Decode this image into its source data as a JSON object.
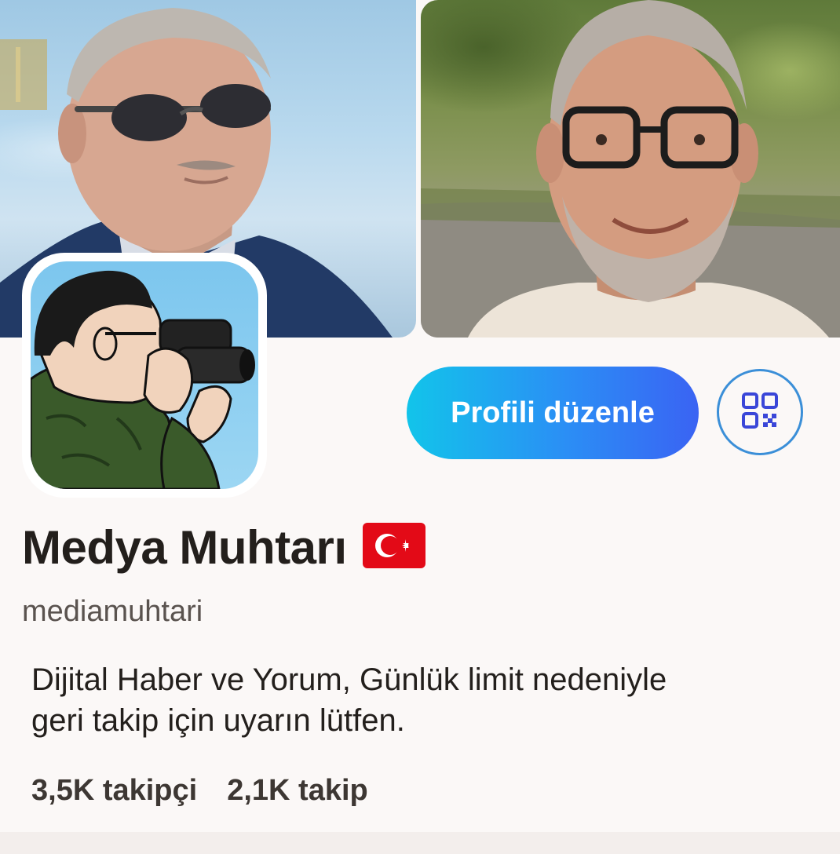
{
  "profile": {
    "display_name": "Medya Muhtarı",
    "flag_emoji": "🇹🇷",
    "handle": "mediamuhtari",
    "bio_line1": "Dijital Haber ve Yorum, Günlük limit nedeniyle",
    "bio_line2": "geri takip için uyarın lütfen.",
    "followers_label": "3,5K takipçi",
    "following_label": "2,1K takip"
  },
  "actions": {
    "edit_profile_label": "Profili düzenle",
    "qr_icon": "qr-code-icon"
  },
  "banner": {
    "left_photo": "man-sunglasses-photo",
    "right_photo": "man-glasses-smiling-photo"
  },
  "avatar": {
    "image": "man-with-binoculars-cartoon"
  },
  "colors": {
    "background": "#fbf8f7",
    "button_gradient_start": "#12c4ea",
    "button_gradient_end": "#3a63f3",
    "qr_ring": "#3b8fd8",
    "qr_icon": "#3a46d8",
    "text_primary": "#231f1c",
    "text_secondary": "#5a534f",
    "flag_red": "#e30a17"
  }
}
